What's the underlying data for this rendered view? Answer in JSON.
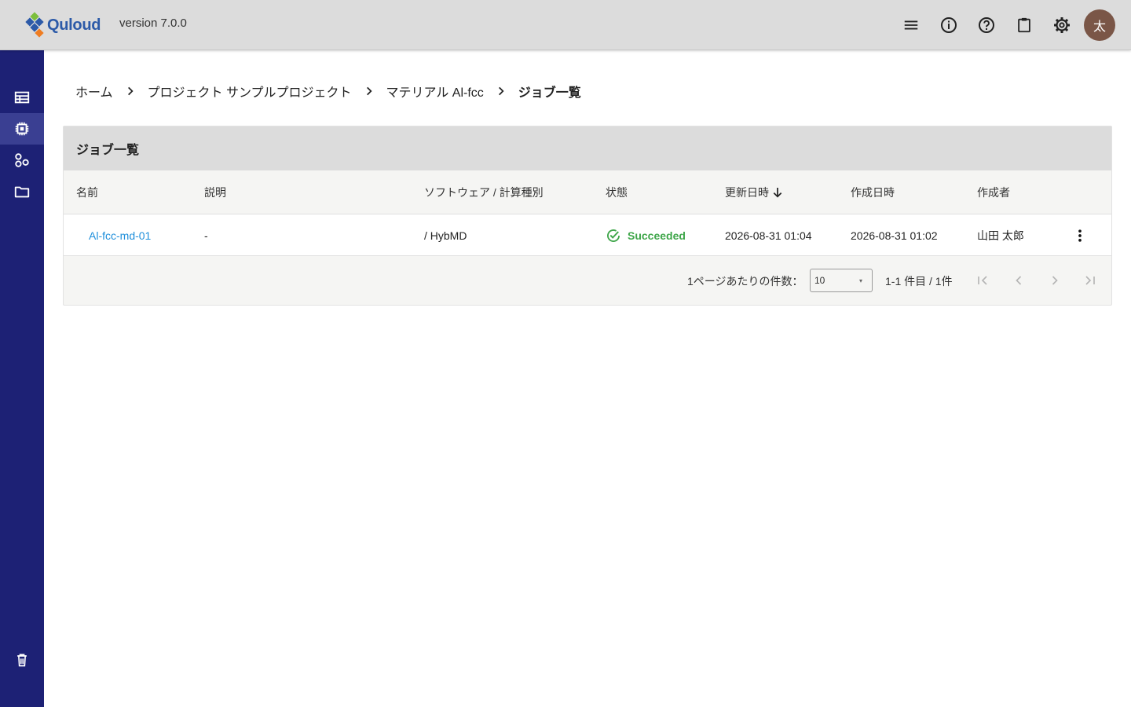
{
  "header": {
    "logo_text": "Quloud",
    "version": "version 7.0.0",
    "avatar_initial": "太",
    "icons": [
      "menu-icon",
      "info-icon",
      "help-icon",
      "clipboard-icon",
      "gear-icon"
    ]
  },
  "sidebar": {
    "items": [
      {
        "icon": "table-icon"
      },
      {
        "icon": "chip-icon",
        "active": true
      },
      {
        "icon": "shapes-icon"
      },
      {
        "icon": "folder-icon"
      }
    ],
    "bottom_icon": "trash-icon"
  },
  "breadcrumb": {
    "items": [
      "ホーム",
      "プロジェクト サンプルプロジェクト",
      "マテリアル Al-fcc"
    ],
    "current": "ジョブ一覧"
  },
  "card": {
    "title": "ジョブ一覧"
  },
  "table": {
    "columns": [
      "名前",
      "説明",
      "ソフトウェア / 計算種別",
      "状態",
      "更新日時",
      "作成日時",
      "作成者"
    ],
    "sort_column": "更新日時",
    "sort_direction": "descending",
    "rows": [
      {
        "name": "Al-fcc-md-01",
        "description": "-",
        "software": "/ HybMD",
        "status": "Succeeded",
        "updated": "2026-08-31 01:04",
        "created": "2026-08-31 01:02",
        "author": "山田 太郎"
      }
    ]
  },
  "pagination": {
    "per_page_label": "1ページあたりの件数：",
    "per_page_value": "10",
    "range": "1-1 件目 / 1件"
  },
  "colors": {
    "topbar": "#dcdcdc",
    "sidebar": "#1d2175",
    "link": "#1f8fdb",
    "success": "#3fa64a",
    "avatar": "#7a5647"
  }
}
